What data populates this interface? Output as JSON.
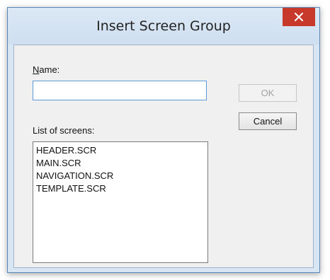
{
  "window": {
    "title": "Insert Screen Group"
  },
  "form": {
    "name_label_underlined": "N",
    "name_label_rest": "ame:",
    "name_value": "",
    "list_label": "List of screens:"
  },
  "buttons": {
    "ok_label": "OK",
    "cancel_label": "Cancel"
  },
  "screens": [
    "HEADER.SCR",
    "MAIN.SCR",
    "NAVIGATION.SCR",
    "TEMPLATE.SCR"
  ],
  "icons": {
    "close": "close-icon"
  },
  "colors": {
    "close_button": "#c7392b",
    "title_bar": "#d8e6f3",
    "input_border_focus": "#5b9bd8"
  }
}
